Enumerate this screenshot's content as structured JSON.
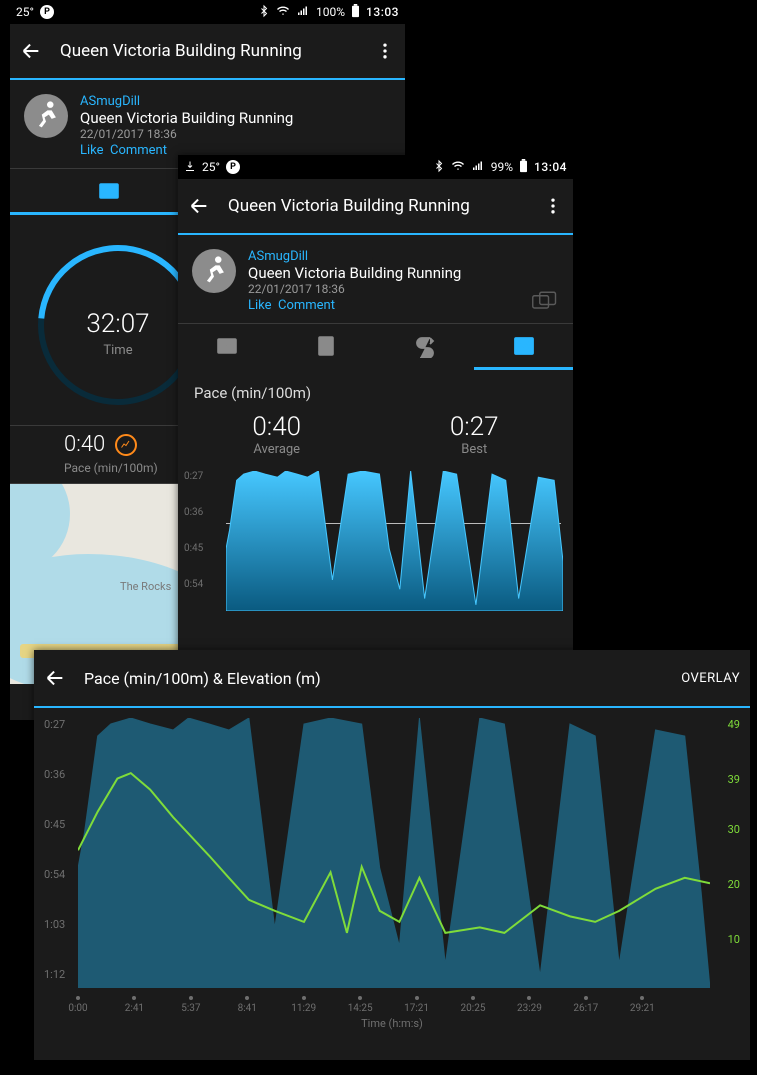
{
  "status": {
    "tempA": "25°",
    "tempB": "25°",
    "clockA": "13:03",
    "clockB": "13:04",
    "battA": "100%",
    "battB": "99%"
  },
  "header": {
    "title": "Queen Victoria Building Running"
  },
  "post": {
    "user": "ASmugDill",
    "activity": "Queen Victoria Building Running",
    "date": "22/01/2017 18:36",
    "like": "Like",
    "comment": "Comment"
  },
  "summary": {
    "time_value": "32:07",
    "time_label": "Time",
    "pace_value": "0:40",
    "pace_label": "Pace (min/100m)"
  },
  "pace": {
    "title": "Pace (min/100m)",
    "avg_value": "0:40",
    "avg_label": "Average",
    "best_value": "0:27",
    "best_label": "Best",
    "y_ticks": [
      "0:27",
      "0:36",
      "0:45",
      "0:54"
    ]
  },
  "overlay": {
    "title": "Pace (min/100m) & Elevation (m)",
    "button": "OVERLAY",
    "x_title": "Time (h:m:s)",
    "x_ticks": [
      "0:00",
      "2:41",
      "5:37",
      "8:41",
      "11:29",
      "14:25",
      "17:21",
      "20:25",
      "23:29",
      "26:17",
      "29:21"
    ],
    "y_left": [
      "0:27",
      "0:36",
      "0:45",
      "0:54",
      "1:03",
      "1:12"
    ],
    "y_right": [
      "49",
      "39",
      "30",
      "20",
      "10"
    ]
  },
  "map": {
    "place_label": "The Rocks"
  },
  "chart_data": [
    {
      "type": "area",
      "title": "Pace (min/100m)",
      "ylabel": "Pace (min/100m)",
      "ylim_seconds": [
        27,
        72
      ],
      "y_ticks": [
        "0:27",
        "0:36",
        "0:45",
        "0:54"
      ],
      "summary": {
        "average": "0:40",
        "best": "0:27"
      },
      "x_seconds": [
        0,
        20,
        60,
        100,
        161,
        220,
        290,
        337,
        400,
        460,
        521,
        600,
        689,
        770,
        865,
        920,
        980,
        1041,
        1120,
        1225,
        1300,
        1409,
        1500,
        1577,
        1650,
        1761,
        1850,
        1900
      ],
      "pace_seconds": [
        52,
        46,
        30,
        28,
        27,
        28,
        29,
        27,
        28,
        29,
        27,
        62,
        28,
        27,
        28,
        52,
        65,
        27,
        68,
        27,
        28,
        70,
        28,
        30,
        68,
        29,
        30,
        56
      ]
    },
    {
      "type": "line",
      "title": "Pace (min/100m) & Elevation (m)",
      "xlabel": "Time (h:m:s)",
      "x_ticks": [
        "0:00",
        "2:41",
        "5:37",
        "8:41",
        "11:29",
        "14:25",
        "17:21",
        "20:25",
        "23:29",
        "26:17",
        "29:21"
      ],
      "series": [
        {
          "name": "Pace (min/100m)",
          "axis": "left",
          "ylim_seconds": [
            27,
            72
          ],
          "y_ticks": [
            "0:27",
            "0:36",
            "0:45",
            "0:54",
            "1:03",
            "1:12"
          ],
          "x_seconds": [
            0,
            20,
            60,
            100,
            161,
            220,
            290,
            337,
            400,
            460,
            521,
            600,
            689,
            770,
            865,
            920,
            980,
            1041,
            1120,
            1225,
            1300,
            1409,
            1500,
            1577,
            1650,
            1761,
            1850,
            1900
          ],
          "y_seconds": [
            52,
            46,
            30,
            28,
            27,
            28,
            29,
            27,
            28,
            29,
            27,
            62,
            28,
            27,
            28,
            52,
            65,
            27,
            68,
            27,
            28,
            70,
            28,
            30,
            68,
            29,
            30,
            56
          ]
        },
        {
          "name": "Elevation (m)",
          "axis": "right",
          "ylim": [
            0,
            49
          ],
          "y_ticks": [
            49,
            39,
            30,
            20,
            10
          ],
          "x_seconds": [
            0,
            60,
            120,
            161,
            220,
            290,
            337,
            400,
            460,
            521,
            600,
            689,
            770,
            820,
            865,
            920,
            980,
            1041,
            1120,
            1225,
            1300,
            1409,
            1500,
            1577,
            1650,
            1761,
            1850,
            1927
          ],
          "y_m": [
            25,
            32,
            38,
            39,
            36,
            31,
            28,
            24,
            20,
            16,
            14,
            12,
            21,
            10,
            22,
            14,
            12,
            20,
            10,
            11,
            10,
            15,
            13,
            12,
            14,
            18,
            20,
            19
          ]
        }
      ]
    }
  ]
}
